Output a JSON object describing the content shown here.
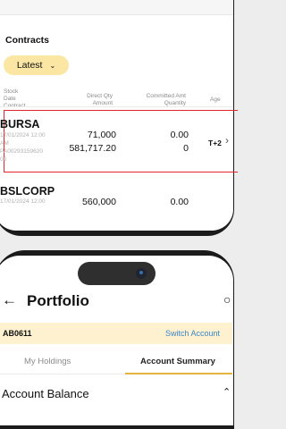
{
  "contracts": {
    "title": "Contracts",
    "filter": "Latest",
    "headers": {
      "stock": [
        "Stock",
        "Date",
        "Contract"
      ],
      "qty": [
        "Direct Qty",
        "Amount"
      ],
      "committed": [
        "Committed Amt",
        "Quantity"
      ],
      "age": "Age"
    },
    "rows": [
      {
        "ticker": "BURSA",
        "date": "17/01/2024 12:00",
        "ampm": "AM",
        "contract": "PA00293159620",
        "contract_cont": "00",
        "direct_qty": "71,000",
        "amount": "581,717.20",
        "committed_amt": "0.00",
        "quantity": "0",
        "age": "T+2"
      },
      {
        "ticker": "BSLCORP",
        "date": "17/01/2024 12:00",
        "direct_qty": "560,000",
        "committed_amt": "0.00"
      }
    ]
  },
  "portfolio": {
    "title": "Portfolio",
    "account_id": "AB0611",
    "switch_account": "Switch Account",
    "tabs": [
      "My Holdings",
      "Account Summary"
    ],
    "active_tab": "Account Summary",
    "section_title": "Account Balance"
  },
  "colors": {
    "highlight": "#e3262e",
    "accent_yellow": "#fbe7a3",
    "link_blue": "#3a86c8"
  }
}
